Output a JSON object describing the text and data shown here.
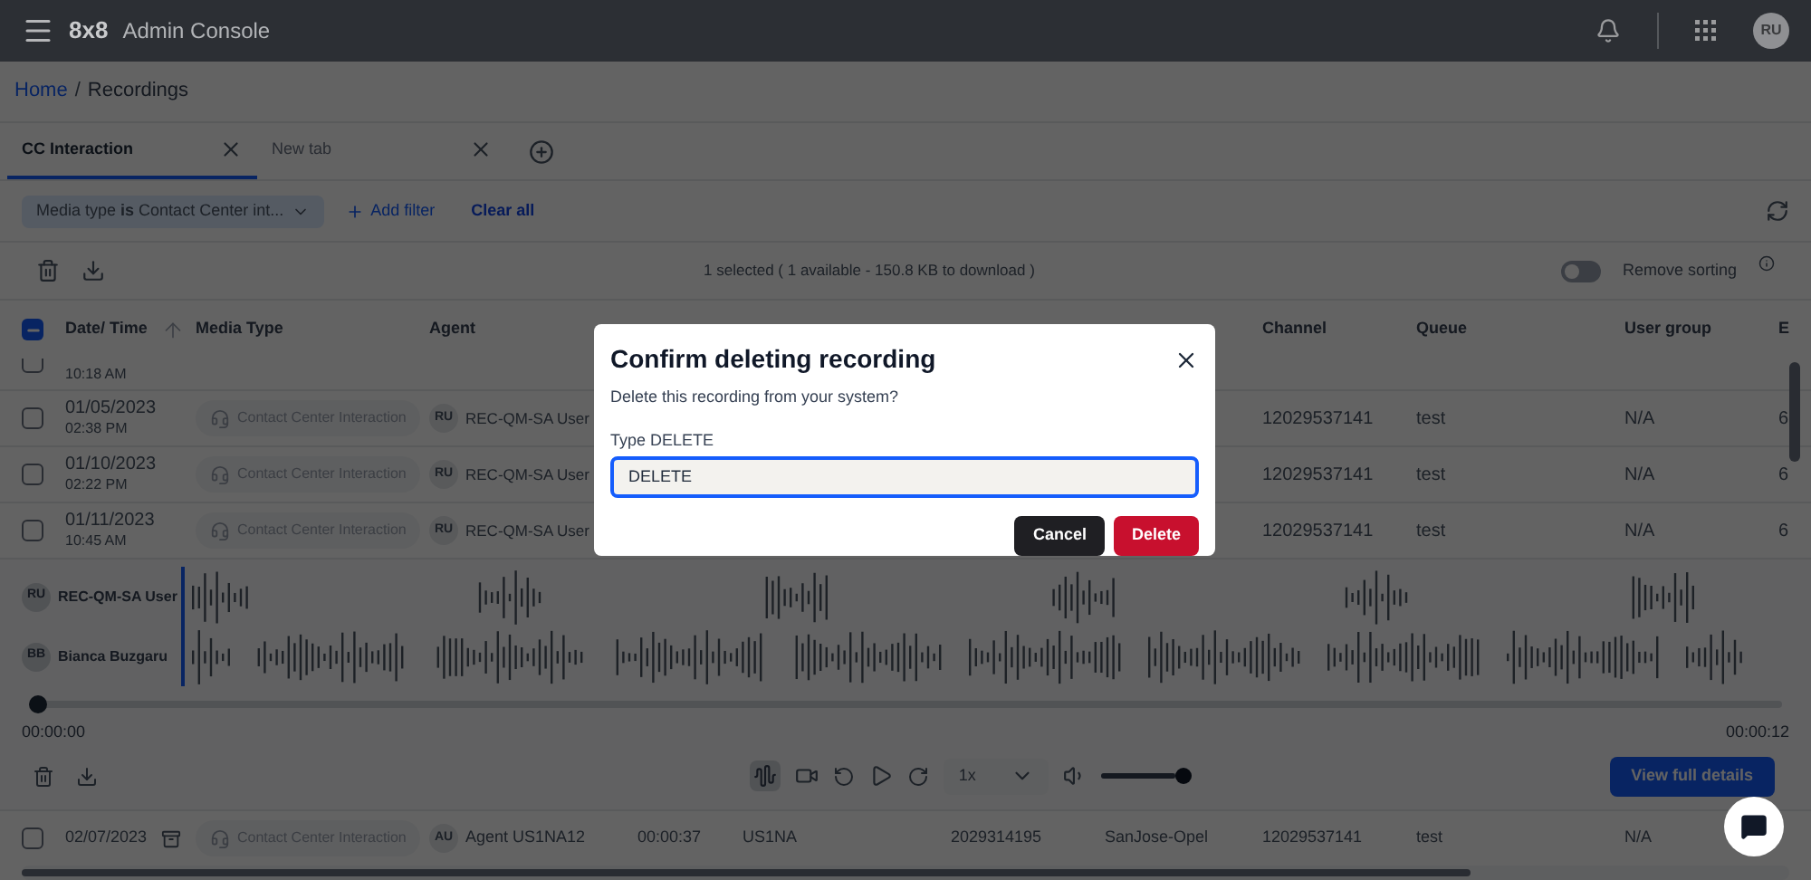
{
  "top_bar": {
    "logo": "8x8",
    "title": "Admin Console",
    "user_initials": "RU"
  },
  "breadcrumb": {
    "items": [
      {
        "label": "Home",
        "link": true
      },
      {
        "label": "Recordings",
        "link": false
      }
    ],
    "separator": "/"
  },
  "tabs": [
    {
      "label": "CC Interaction",
      "selected": true
    },
    {
      "label": "New tab",
      "selected": false
    }
  ],
  "filters": {
    "chips": [
      "Media type **is** Contact Center int..."
    ],
    "add_filter": "Add filter",
    "clear_all": "Clear all"
  },
  "toolbar": {
    "selection_summary": "1 selected ( 1 available - 150.8 KB to download )",
    "remove_sorting": {
      "label": "Remove sorting",
      "on": false
    }
  },
  "table": {
    "all_checkbox": {
      "indeterminate": true
    },
    "columns": [
      {
        "label": "Date/ Time",
        "sorted": true
      },
      {
        "label": "Media Type"
      },
      {
        "label": "Agent"
      },
      {
        "label": "Channel"
      },
      {
        "label": "Queue"
      },
      {
        "label": "User group"
      },
      {
        "label": "E"
      }
    ],
    "rows": [
      {
        "checked": false,
        "time": "10:18 AM"
      },
      {
        "checked": false,
        "date": "01/05/2023",
        "time": "02:38 PM",
        "media_type": "Contact Center Interaction",
        "agent": {
          "initials": "RU",
          "name": "REC-QM-SA User"
        },
        "channel": "12029537141",
        "queue": "test",
        "user_group": "N/A",
        "column_12": "6"
      },
      {
        "checked": false,
        "date": "01/10/2023",
        "time": "02:22 PM",
        "media_type": "Contact Center Interaction",
        "agent": {
          "initials": "RU",
          "name": "REC-QM-SA User"
        },
        "channel": "12029537141",
        "queue": "test",
        "user_group": "N/A",
        "column_12": "6"
      },
      {
        "checked": false,
        "date": "01/11/2023",
        "time": "10:45 AM",
        "media_type": "Contact Center Interaction",
        "agent": {
          "initials": "RU",
          "name": "REC-QM-SA User"
        },
        "channel": "12029537141",
        "queue": "test",
        "user_group": "N/A",
        "column_12": "6"
      }
    ],
    "last_row": {
      "checked": false,
      "date": "02/07/2023",
      "media_type": "Contact Center Interaction",
      "agent": {
        "initials": "AU",
        "name": "Agent US1NA12"
      },
      "column_5": "00:00:37",
      "column_6": "US1NA",
      "column_7": "2029314195",
      "column_8": "SanJose-Opel",
      "channel": "12029537141",
      "queue": "test",
      "user_group": "N/A"
    }
  },
  "player": {
    "speakers": [
      {
        "initials": "RU",
        "name": "REC-QM-SA User"
      },
      {
        "initials": "BB",
        "name": "Bianca Buzgaru"
      }
    ],
    "progress": {
      "level": 0
    },
    "start_time": "00:00:00",
    "end_time": "00:00:12",
    "waveform_view": {
      "on": true
    },
    "speed": "1x",
    "volume": {
      "level": 1
    },
    "details_button": "View full details"
  },
  "dialog": {
    "title": "Confirm deleting recording",
    "message": "Delete this recording from your system?",
    "field_label": "Type DELETE",
    "field_value": "DELETE",
    "buttons": [
      {
        "label": "Cancel",
        "kind": "secondary"
      },
      {
        "label": "Delete",
        "kind": "danger"
      }
    ]
  }
}
